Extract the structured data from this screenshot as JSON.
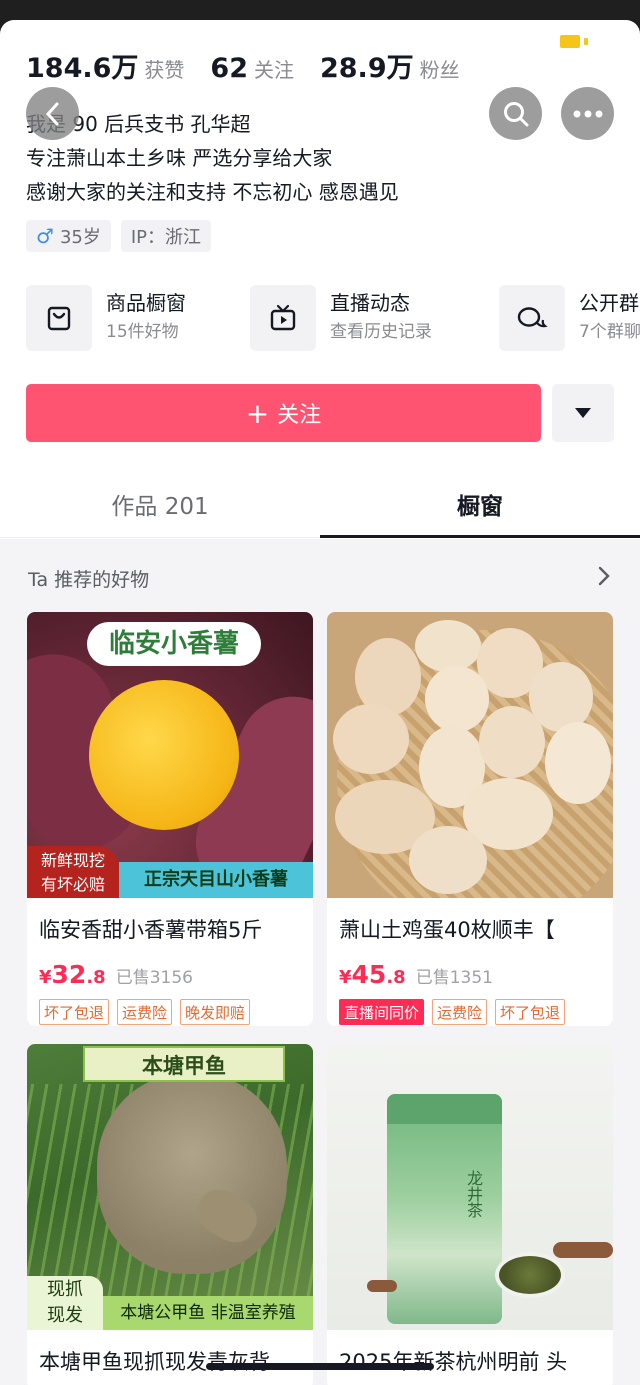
{
  "stats": [
    {
      "num": "184.6万",
      "label": "获赞"
    },
    {
      "num": "62",
      "label": "关注"
    },
    {
      "num": "28.9万",
      "label": "粉丝"
    }
  ],
  "bio": {
    "line1": "我是 90 后兵支书 孔华超",
    "line2": "专注萧山本土乡味  严选分享给大家",
    "line3": "感谢大家的关注和支持 不忘初心 感恩遇见"
  },
  "chips": {
    "age": "35岁",
    "ip": "IP：浙江",
    "gender_symbol": "♂"
  },
  "entries": [
    {
      "title": "商品橱窗",
      "sub": "15件好物",
      "icon": "bag-icon"
    },
    {
      "title": "直播动态",
      "sub": "查看历史记录",
      "icon": "tv-icon"
    },
    {
      "title": "公开群",
      "sub": "7个群聊",
      "icon": "chat-icon"
    }
  ],
  "follow": {
    "label": "关注",
    "plus": "+"
  },
  "tabs": {
    "works": "作品 201",
    "shop": "橱窗"
  },
  "recommend": {
    "title": "Ta 推荐的好物"
  },
  "products": [
    {
      "title": "临安香甜小香薯带箱5斤",
      "price_symbol": "¥",
      "price_int": "32",
      "price_dec": ".8",
      "sold": "已售3156",
      "tags": [
        "坏了包退",
        "运费险",
        "晚发即赔"
      ],
      "img_banner": "临安小香薯",
      "img_badge": "新鲜现挖\n有坏必赔",
      "img_footer": "正宗天目山小香薯"
    },
    {
      "title": "萧山土鸡蛋40枚顺丰【",
      "price_symbol": "¥",
      "price_int": "45",
      "price_dec": ".8",
      "sold": "已售1351",
      "tags": [
        "直播间同价",
        "运费险",
        "坏了包退"
      ]
    },
    {
      "title": "本塘甲鱼现抓现发青灰背",
      "img_banner": "本塘甲鱼",
      "img_badge": "现抓\n现发",
      "img_footer": "本塘公甲鱼  非温室养殖"
    },
    {
      "title": "2025年新茶杭州明前 头",
      "img_label": "龙井茶"
    }
  ],
  "colors": {
    "accent": "#fe5471",
    "price": "#fe2c55",
    "tag_border": "#f7a27a",
    "muted": "#8a8b91"
  }
}
